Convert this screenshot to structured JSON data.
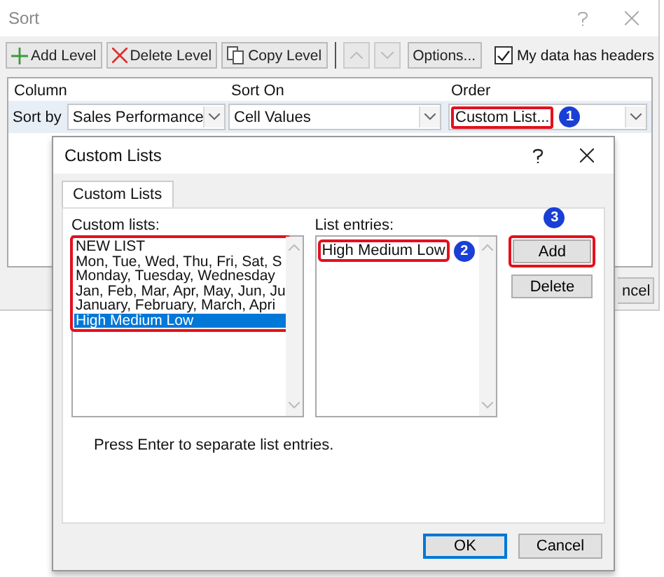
{
  "sort_dialog": {
    "title": "Sort",
    "toolbar": [
      {
        "kind": "add",
        "label": "Add Level"
      },
      {
        "kind": "delete",
        "label": "Delete Level"
      },
      {
        "kind": "copy",
        "label": "Copy Level"
      },
      {
        "kind": "up"
      },
      {
        "kind": "down"
      },
      {
        "kind": "options",
        "label": "Options..."
      }
    ],
    "headers_checkbox": {
      "label": "My data has headers",
      "checked": true
    },
    "columns": [
      "Column",
      "Sort On",
      "Order"
    ],
    "row": {
      "label": "Sort by",
      "column": "Sales Performance",
      "sort_on": "Cell Values",
      "order": "Custom List...",
      "order_badge": "1"
    },
    "cancel_fragment": "ncel"
  },
  "custom_lists_dialog": {
    "title": "Custom Lists",
    "tabs": [
      {
        "label": "Custom Lists",
        "selected": true
      }
    ],
    "lists_label": "Custom lists:",
    "lists": [
      {
        "label": "NEW LIST",
        "selected": false
      },
      {
        "label": "Mon, Tue, Wed, Thu, Fri, Sat, S",
        "selected": false
      },
      {
        "label": "Monday, Tuesday, Wednesday",
        "selected": false
      },
      {
        "label": "Jan, Feb, Mar, Apr, May, Jun, Ju",
        "selected": false
      },
      {
        "label": "January, February, March, Apri",
        "selected": false
      },
      {
        "label": "High Medium Low",
        "selected": true
      }
    ],
    "entries_label": "List entries:",
    "entries": "High Medium Low",
    "entries_badge": "2",
    "add": "Add",
    "add_badge": "3",
    "delete": "Delete",
    "hint": "Press Enter to separate list entries.",
    "ok": "OK",
    "cancel": "Cancel"
  }
}
